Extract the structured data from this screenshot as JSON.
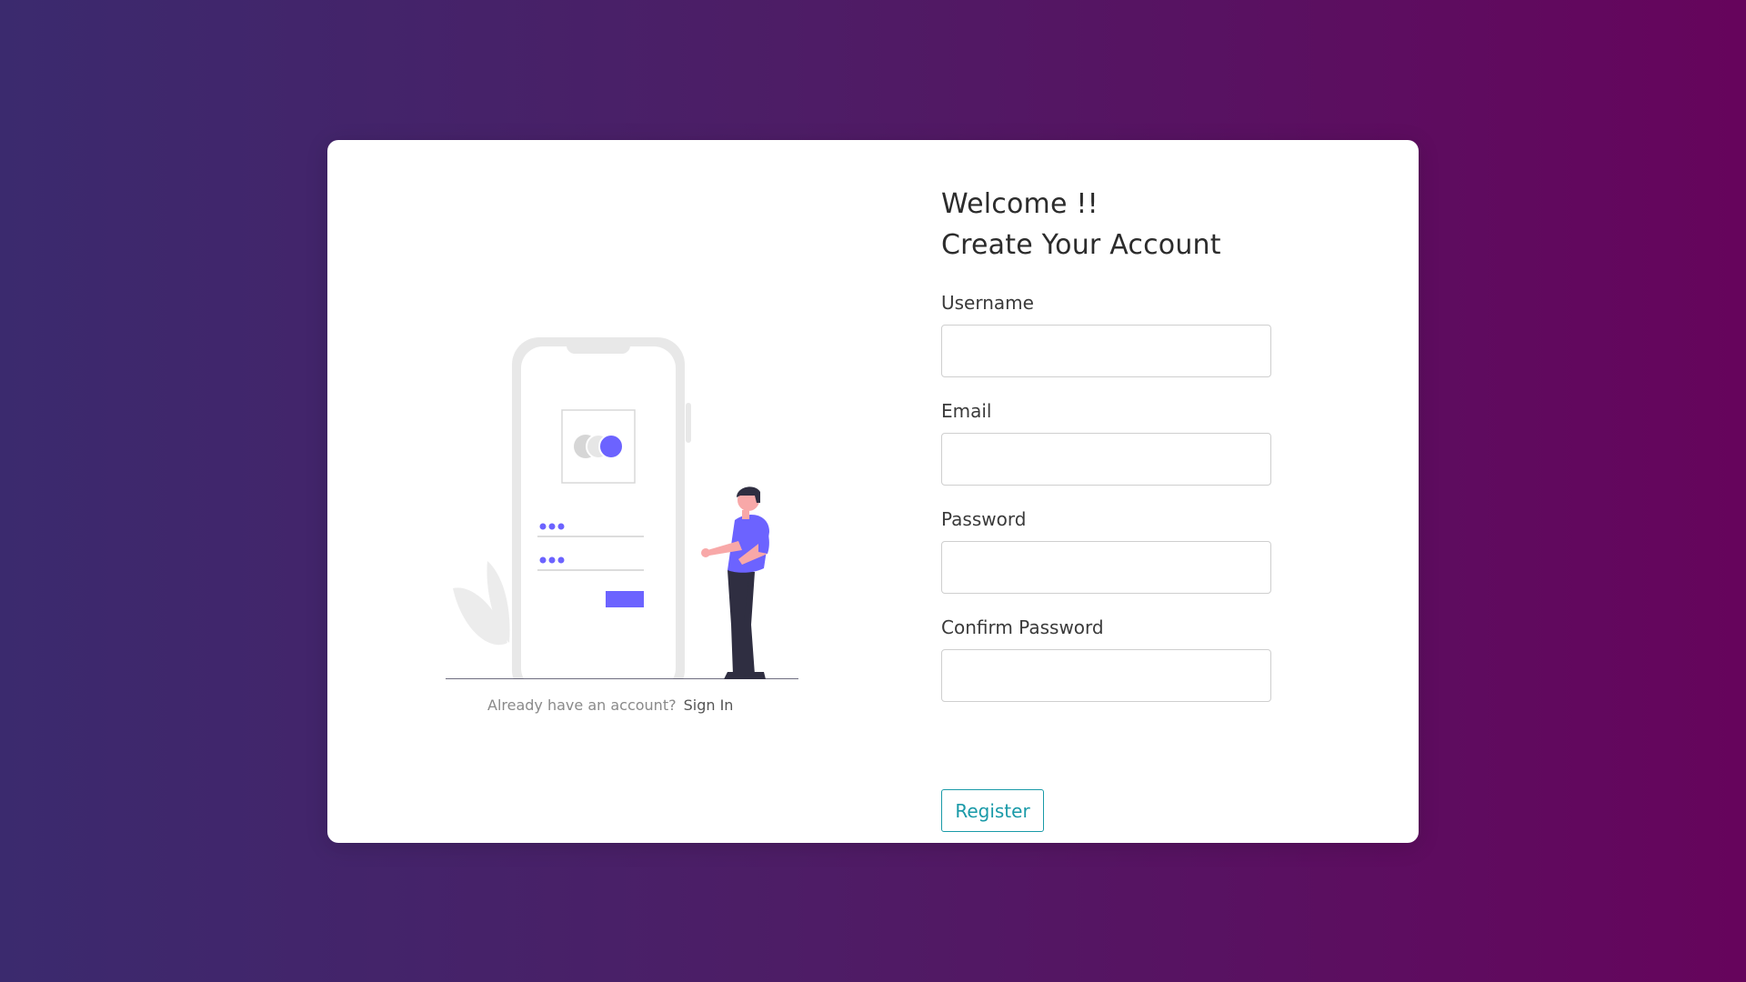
{
  "illustration": {
    "accent_color": "#6c63ff",
    "decoration": "phone-login-person-illustration"
  },
  "signin": {
    "prompt": "Already have an account?",
    "link_label": "Sign In"
  },
  "form": {
    "welcome": "Welcome !!",
    "title": "Create Your Account",
    "fields": [
      {
        "label": "Username",
        "value": "",
        "placeholder": ""
      },
      {
        "label": "Email",
        "value": "",
        "placeholder": ""
      },
      {
        "label": "Password",
        "value": "",
        "placeholder": ""
      },
      {
        "label": "Confirm Password",
        "value": "",
        "placeholder": ""
      }
    ],
    "register_label": "Register"
  },
  "colors": {
    "background_start": "#3b2a6e",
    "background_end": "#66045c",
    "button_accent": "#1a9aa8"
  }
}
